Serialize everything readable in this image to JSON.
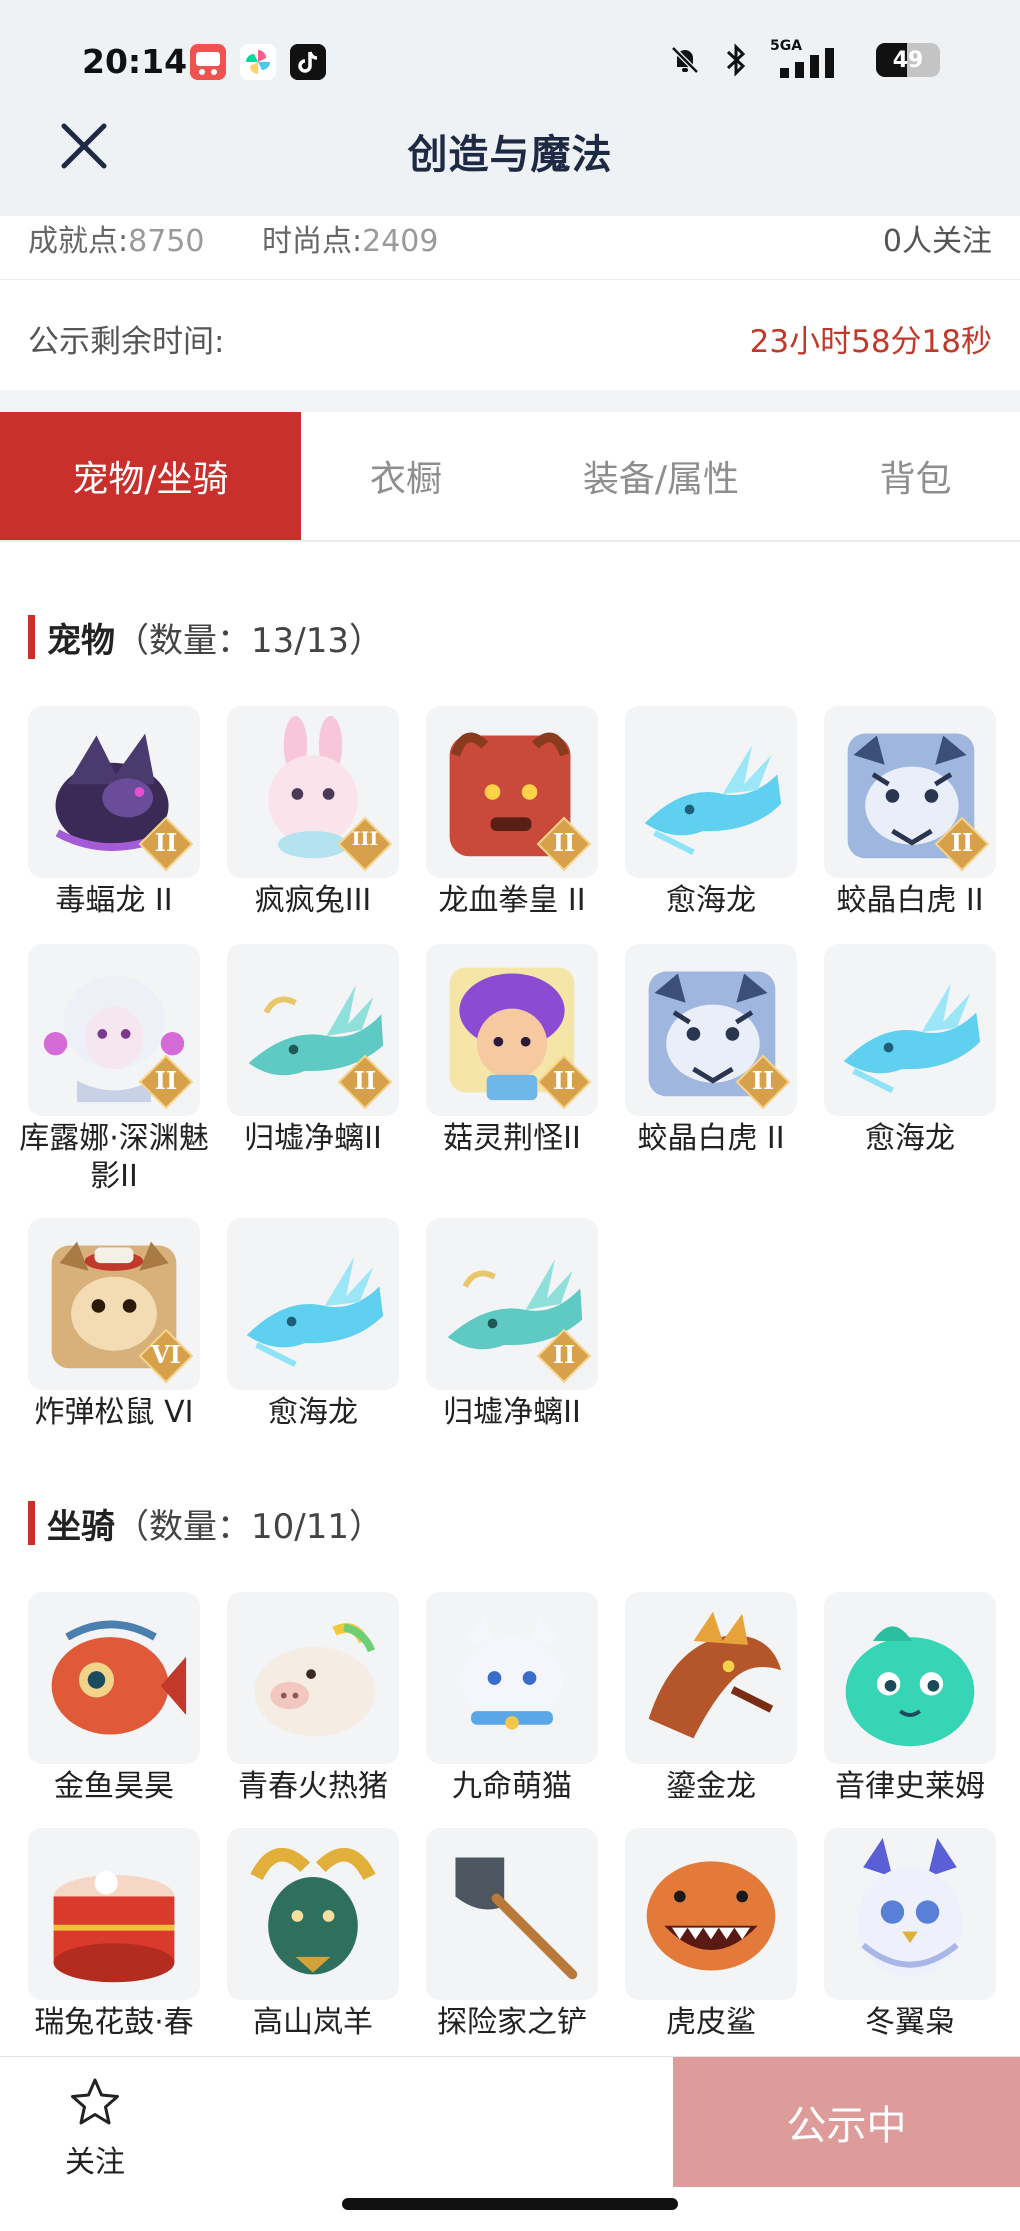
{
  "status_bar": {
    "time": "20:14",
    "network": "5GA",
    "battery_level": "49",
    "battery_fraction": 0.49,
    "app_icons": [
      "618-app-icon",
      "pinwheel-app-icon",
      "tiktok-icon"
    ],
    "status_icons": [
      "bell-off-icon",
      "bluetooth-icon",
      "signal-icon",
      "battery-icon"
    ]
  },
  "nav": {
    "title": "创造与魔法",
    "close_icon": "close-icon"
  },
  "info": {
    "achievement_label": "成就点:",
    "achievement_value": "8750",
    "fashion_label": "时尚点:",
    "fashion_value": "2409",
    "followers": "0人关注",
    "remaining_label": "公示剩余时间:",
    "remaining_value": "23小时58分18秒"
  },
  "tabs": [
    {
      "label": "宠物/坐骑",
      "active": true
    },
    {
      "label": "衣橱",
      "active": false
    },
    {
      "label": "装备/属性",
      "active": false
    },
    {
      "label": "背包",
      "active": false
    }
  ],
  "pets": {
    "title": "宠物",
    "count": "（数量：13/13）",
    "items": [
      {
        "name": "毒蝠龙 II",
        "badge": "II",
        "art": "dark-dragon"
      },
      {
        "name": "疯疯兔III",
        "badge": "III",
        "art": "bunny"
      },
      {
        "name": "龙血拳皇 II",
        "badge": "II",
        "art": "red-beast"
      },
      {
        "name": "愈海龙",
        "badge": "",
        "art": "sea-dragon"
      },
      {
        "name": "蛟晶白虎 II",
        "badge": "II",
        "art": "tiger"
      },
      {
        "name": "库露娜·深渊魅影II",
        "badge": "II",
        "art": "spirit-girl"
      },
      {
        "name": "归墟净螭II",
        "badge": "II",
        "art": "jade-dragon"
      },
      {
        "name": "菇灵荆怪II",
        "badge": "II",
        "art": "mushroom-kid"
      },
      {
        "name": "蛟晶白虎 II",
        "badge": "II",
        "art": "tiger"
      },
      {
        "name": "愈海龙",
        "badge": "",
        "art": "sea-dragon"
      },
      {
        "name": "炸弹松鼠 VI",
        "badge": "VI",
        "art": "squirrel"
      },
      {
        "name": "愈海龙",
        "badge": "",
        "art": "sea-dragon"
      },
      {
        "name": "归墟净螭II",
        "badge": "II",
        "art": "jade-dragon"
      }
    ]
  },
  "mounts": {
    "title": "坐骑",
    "count": "（数量：10/11）",
    "items": [
      {
        "name": "金鱼昊昊",
        "art": "goldfish"
      },
      {
        "name": "青春火热猪",
        "art": "pig"
      },
      {
        "name": "九命萌猫",
        "art": "white-cat"
      },
      {
        "name": "鎏金龙",
        "art": "gold-dragon"
      },
      {
        "name": "音律史莱姆",
        "art": "slime"
      },
      {
        "name": "瑞兔花鼓·春",
        "art": "drum"
      },
      {
        "name": "高山岚羊",
        "art": "goat"
      },
      {
        "name": "探险家之铲",
        "art": "shovel"
      },
      {
        "name": "虎皮鲨",
        "art": "shark"
      },
      {
        "name": "冬翼枭",
        "art": "owl"
      }
    ]
  },
  "bottom": {
    "favorite_label": "关注",
    "favorite_icon": "star-icon",
    "action_label": "公示中"
  }
}
